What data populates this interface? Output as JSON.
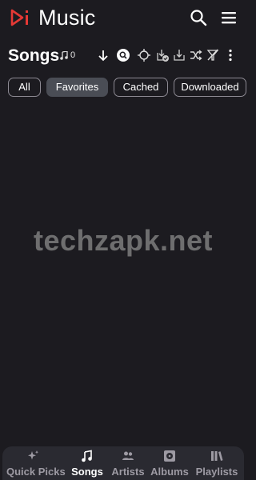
{
  "app": {
    "title": "Music",
    "logo_icon": "play-pause-logo-icon",
    "accent_color": "#e53935"
  },
  "header_actions": {
    "search_icon": "search-icon",
    "menu_icon": "hamburger-menu-icon"
  },
  "section": {
    "title": "Songs",
    "count": "0",
    "count_icon": "music-note-icon",
    "tools": [
      "arrow-down-icon",
      "search-circle-icon",
      "locate-icon",
      "download-done-icon",
      "download-icon",
      "shuffle-icon",
      "clear-filter-icon",
      "more-vertical-icon"
    ]
  },
  "filters": [
    {
      "label": "All",
      "selected": false
    },
    {
      "label": "Favorites",
      "selected": true
    },
    {
      "label": "Cached",
      "selected": false
    },
    {
      "label": "Downloaded",
      "selected": false
    }
  ],
  "watermark": "techzapk.net",
  "bottom_nav": [
    {
      "label": "Quick Picks",
      "icon": "sparkle-icon",
      "active": false
    },
    {
      "label": "Songs",
      "icon": "music-note-icon",
      "active": true
    },
    {
      "label": "Artists",
      "icon": "people-icon",
      "active": false
    },
    {
      "label": "Albums",
      "icon": "album-icon",
      "active": false
    },
    {
      "label": "Playlists",
      "icon": "library-icon",
      "active": false
    }
  ]
}
